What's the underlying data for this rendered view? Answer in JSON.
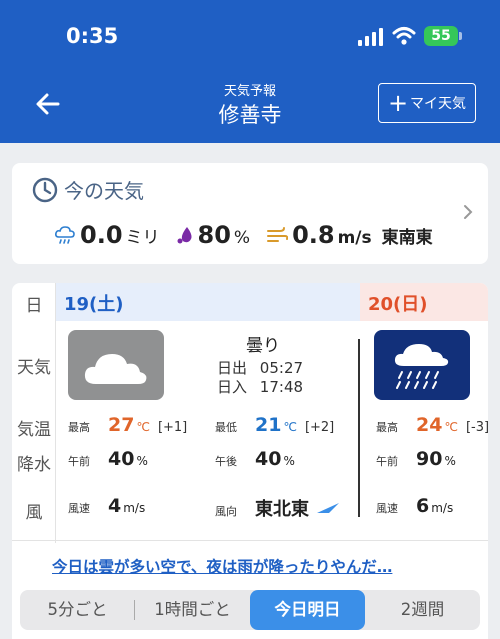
{
  "status": {
    "time": "0:35",
    "battery": "55"
  },
  "header": {
    "subtitle": "天気予報",
    "title": "修善寺",
    "my_weather_button": "マイ天気"
  },
  "now": {
    "title": "今の天気",
    "rain_value": "0.0",
    "rain_unit": "ミリ",
    "humidity_value": "80",
    "humidity_unit": "%",
    "wind_value": "0.8",
    "wind_unit": "m/s",
    "wind_dir": "東南東"
  },
  "rows": {
    "day": "日",
    "weather": "天気",
    "temp": "気温",
    "precip": "降水",
    "wind": "風"
  },
  "days": [
    {
      "label": "19(土)",
      "weather": "曇り",
      "sunrise_label": "日出",
      "sunrise": "05:27",
      "sunset_label": "日入",
      "sunset": "17:48",
      "max_label": "最高",
      "max": "27",
      "max_diff": "[+1]",
      "min_label": "最低",
      "min": "21",
      "min_diff": "[+2]",
      "am_label": "午前",
      "am": "40",
      "pm_label": "午後",
      "pm": "40",
      "wind_speed_label": "風速",
      "wind_speed": "4",
      "wind_dir_label": "風向",
      "wind_dir": "東北東"
    },
    {
      "label": "20(日)",
      "max_label": "最高",
      "max": "24",
      "max_diff": "[-3]",
      "am_label": "午前",
      "am": "90",
      "wind_speed_label": "風速",
      "wind_speed": "6"
    }
  ],
  "units": {
    "temp": "℃",
    "percent": "%",
    "speed": "m/s"
  },
  "summary": "今日は雲が多い空で、夜は雨が降ったりやんだ…",
  "tabs": [
    "5分ごと",
    "1時間ごと",
    "今日明日",
    "2週間"
  ],
  "colors": {
    "header": "#1f5fc4",
    "accent": "#3b8fe8",
    "max_temp": "#e0652a",
    "min_temp": "#1f72c8",
    "sunday": "#e0502a"
  }
}
